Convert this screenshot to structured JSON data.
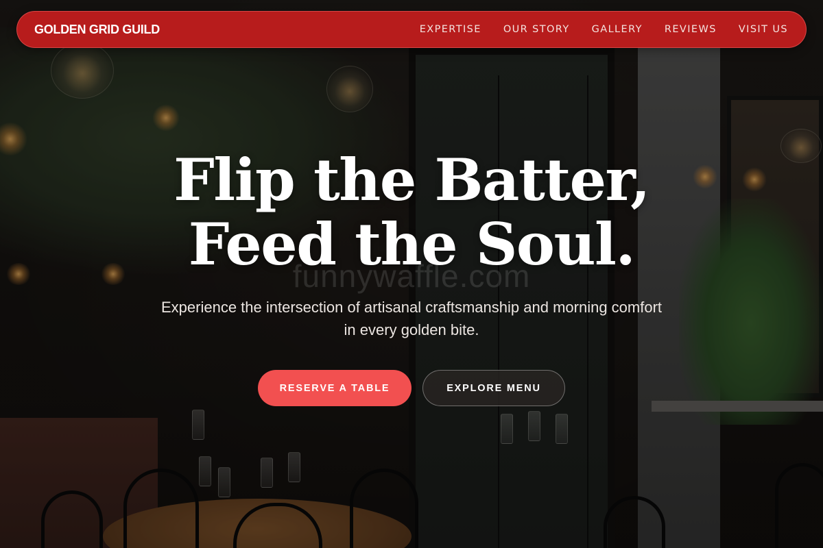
{
  "brand": {
    "name": "GOLDEN GRID GUILD"
  },
  "nav": {
    "items": [
      {
        "label": "EXPERTISE"
      },
      {
        "label": "OUR STORY"
      },
      {
        "label": "GALLERY"
      },
      {
        "label": "REVIEWS"
      },
      {
        "label": "VISIT US"
      }
    ]
  },
  "hero": {
    "headline_line1": "Flip the Batter,",
    "headline_line2": "Feed the Soul.",
    "subtitle_line1": "Experience the intersection of artisanal craftsmanship and morning comfort",
    "subtitle_line2": "in every golden bite.",
    "primary_cta": "RESERVE A TABLE",
    "secondary_cta": "EXPLORE MENU",
    "watermark": "funnywaffle.com"
  },
  "colors": {
    "navbar": "#b71c1c",
    "primary_button": "#f25050",
    "secondary_button": "#2a2624",
    "headline": "#ffffff"
  },
  "background": {
    "description_icon": "restaurant-photo"
  }
}
